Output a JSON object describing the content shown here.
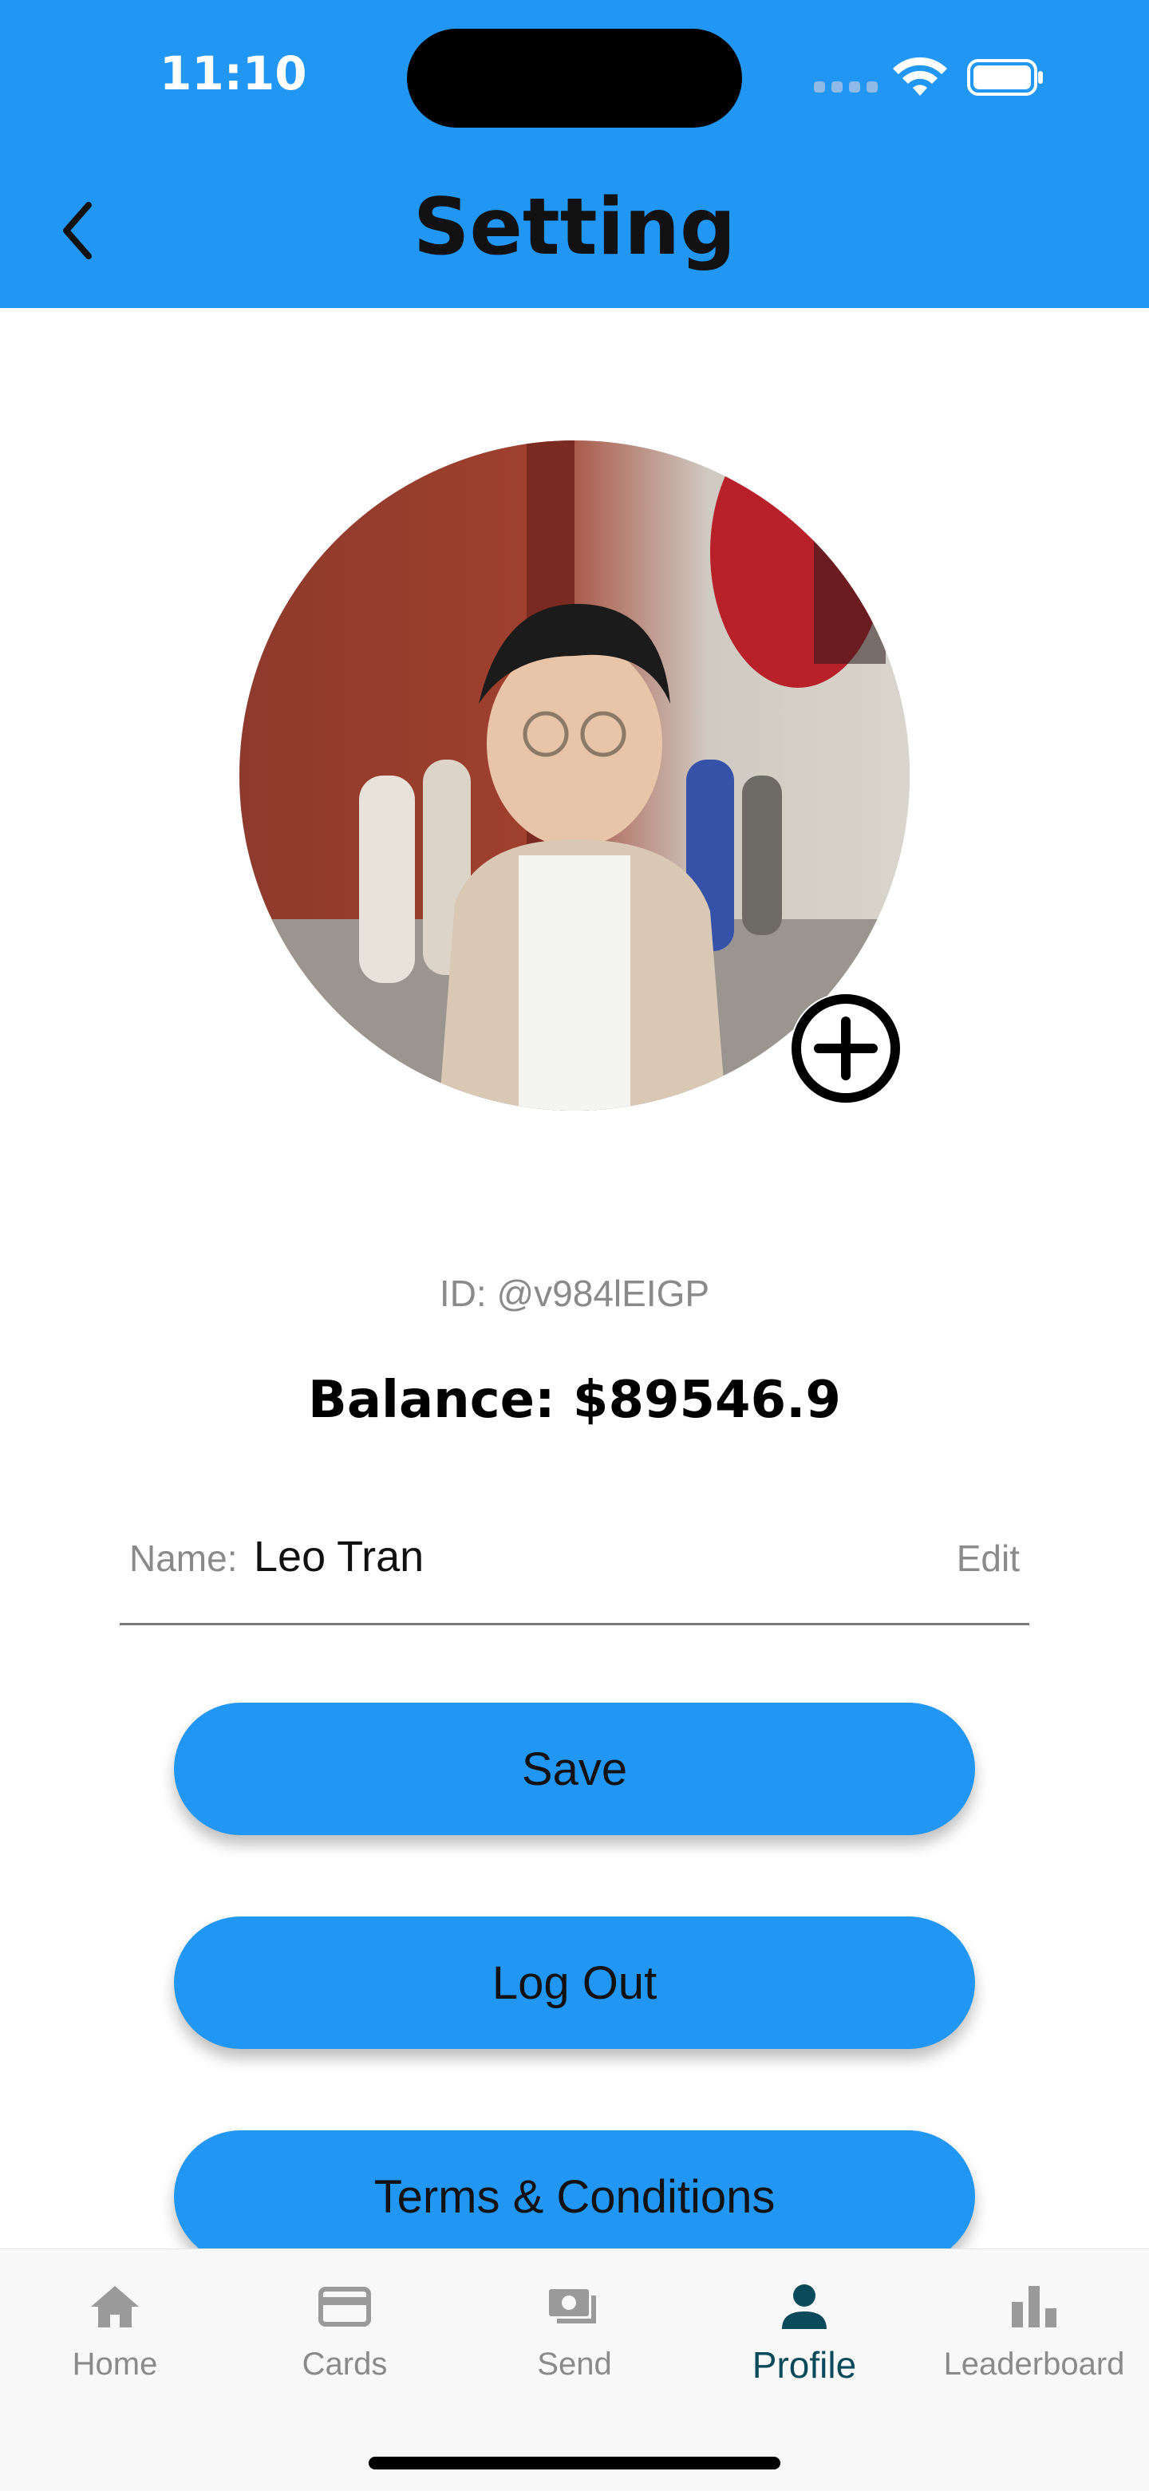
{
  "status_bar": {
    "time": "11:10"
  },
  "header": {
    "title": "Setting",
    "back_icon": "chevron-left-icon"
  },
  "profile": {
    "id_text": "ID: @v984lEIGP",
    "balance_text": "Balance: $89546.9",
    "name_label": "Name:",
    "name_value": "Leo Tran",
    "edit_label": "Edit",
    "add_photo_icon": "plus-circle-icon"
  },
  "buttons": {
    "save": "Save",
    "logout": "Log Out",
    "terms": "Terms & Conditions"
  },
  "bottom_nav": {
    "items": [
      {
        "label": "Home",
        "icon": "home-icon",
        "active": false
      },
      {
        "label": "Cards",
        "icon": "credit-card-icon",
        "active": false
      },
      {
        "label": "Send",
        "icon": "send-money-icon",
        "active": false
      },
      {
        "label": "Profile",
        "icon": "person-icon",
        "active": true
      },
      {
        "label": "Leaderboard",
        "icon": "bar-chart-icon",
        "active": false
      }
    ]
  },
  "colors": {
    "primary": "#2196F3",
    "active_nav": "#0a4a5a",
    "muted_text": "#8a8a8a"
  }
}
